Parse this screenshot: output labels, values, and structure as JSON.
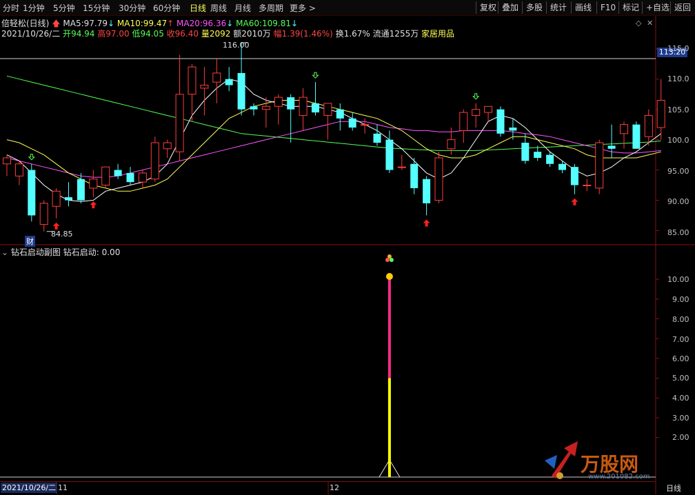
{
  "toolbar": {
    "periods": [
      "分时",
      "1分钟",
      "5分钟",
      "15分钟",
      "30分钟",
      "60分钟",
      "日线",
      "周线",
      "月线",
      "多周期",
      "更多"
    ],
    "active_period": "日线",
    "more_arrow": ">",
    "buttons": [
      "复权",
      "叠加",
      "多股",
      "统计",
      "画线",
      "F10",
      "标记",
      "+自选",
      "返回"
    ]
  },
  "info": {
    "title": "倍轻松(日线)",
    "ma5_label": "MA5:",
    "ma5": "97.79",
    "ma10_label": "MA10:",
    "ma10": "99.47",
    "ma20_label": "MA20:",
    "ma20": "96.36",
    "ma60_label": "MA60:",
    "ma60": "109.81",
    "date": "2021/10/26/二",
    "open_label": "开",
    "open": "94.94",
    "high_label": "高",
    "high": "97.00",
    "low_label": "低",
    "low": "94.05",
    "close_label": "收",
    "close": "96.40",
    "vol_label": "量",
    "vol": "2092",
    "amount_label": "额",
    "amount": "2010万",
    "change_label": "幅",
    "change": "1.39(1.46%)",
    "turnover_label": "换",
    "turnover": "1.67%",
    "float_label": "流通",
    "float": "1255万",
    "sector": "家居用品"
  },
  "price_axis": {
    "labels": [
      "115.0",
      "110.0",
      "105.0",
      "100.0",
      "95.00",
      "90.00",
      "85.00"
    ],
    "current_tag": "113.20"
  },
  "annotations": {
    "high_label": "116.00",
    "low_label": "84.85",
    "cai": "财"
  },
  "sub": {
    "title": "钻石启动副图",
    "value_label": "钻石启动:",
    "value": "0.00",
    "axis_labels": [
      "10.00",
      "9.00",
      "8.00",
      "7.00",
      "6.00",
      "5.00",
      "4.00",
      "3.00",
      "2.00"
    ]
  },
  "bottom": {
    "date": "2021/10/26/二",
    "month1": "11",
    "month2": "12",
    "period_label": "日线"
  },
  "watermark": {
    "text": "万股网",
    "url": "www.201082.com"
  },
  "colors": {
    "up": "#ff3c3c",
    "down": "#54ffff",
    "ma5": "#ffffff",
    "ma10": "#ffff55",
    "ma20": "#ff55ff",
    "ma60": "#55ff55",
    "signal_top": "#ff2a8a",
    "signal_bottom": "#ffff00",
    "border": "#8a1010"
  },
  "chart_data": {
    "type": "candlestick",
    "ylim": [
      83,
      116
    ],
    "candles": [
      {
        "o": 96.0,
        "h": 97.5,
        "l": 94.0,
        "c": 97.0
      },
      {
        "o": 94.0,
        "h": 96.5,
        "l": 92.5,
        "c": 96.0
      },
      {
        "o": 95.0,
        "h": 96.0,
        "l": 86.5,
        "c": 87.5
      },
      {
        "o": 86.0,
        "h": 90.0,
        "l": 84.85,
        "c": 89.5
      },
      {
        "o": 89.0,
        "h": 92.0,
        "l": 87.0,
        "c": 91.5
      },
      {
        "o": 90.5,
        "h": 93.0,
        "l": 89.0,
        "c": 90.0
      },
      {
        "o": 93.5,
        "h": 94.5,
        "l": 89.5,
        "c": 90.0
      },
      {
        "o": 92.0,
        "h": 95.0,
        "l": 90.5,
        "c": 93.5
      },
      {
        "o": 92.5,
        "h": 95.5,
        "l": 92.0,
        "c": 95.5
      },
      {
        "o": 95.0,
        "h": 96.0,
        "l": 93.5,
        "c": 94.0
      },
      {
        "o": 94.5,
        "h": 95.5,
        "l": 92.5,
        "c": 93.0
      },
      {
        "o": 93.0,
        "h": 95.0,
        "l": 92.0,
        "c": 94.5
      },
      {
        "o": 93.5,
        "h": 100.5,
        "l": 93.0,
        "c": 99.5
      },
      {
        "o": 98.5,
        "h": 100.0,
        "l": 97.0,
        "c": 99.5
      },
      {
        "o": 98.0,
        "h": 114.0,
        "l": 96.5,
        "c": 107.5
      },
      {
        "o": 107.5,
        "h": 112.5,
        "l": 103.0,
        "c": 112.0
      },
      {
        "o": 108.5,
        "h": 112.0,
        "l": 104.0,
        "c": 109.0
      },
      {
        "o": 109.5,
        "h": 113.5,
        "l": 106.0,
        "c": 111.0
      },
      {
        "o": 110.0,
        "h": 112.0,
        "l": 108.0,
        "c": 109.0
      },
      {
        "o": 111.0,
        "h": 116.0,
        "l": 104.0,
        "c": 105.0
      },
      {
        "o": 105.5,
        "h": 106.0,
        "l": 104.0,
        "c": 105.0
      },
      {
        "o": 105.0,
        "h": 107.0,
        "l": 102.0,
        "c": 105.5
      },
      {
        "o": 105.5,
        "h": 107.5,
        "l": 102.5,
        "c": 107.0
      },
      {
        "o": 107.0,
        "h": 107.5,
        "l": 99.5,
        "c": 105.0
      },
      {
        "o": 104.0,
        "h": 108.5,
        "l": 101.5,
        "c": 107.0
      },
      {
        "o": 106.0,
        "h": 109.5,
        "l": 104.0,
        "c": 104.5
      },
      {
        "o": 104.0,
        "h": 106.0,
        "l": 100.0,
        "c": 106.0
      },
      {
        "o": 105.0,
        "h": 106.0,
        "l": 101.5,
        "c": 103.5
      },
      {
        "o": 103.5,
        "h": 104.5,
        "l": 101.5,
        "c": 102.0
      },
      {
        "o": 102.5,
        "h": 103.5,
        "l": 101.0,
        "c": 102.5
      },
      {
        "o": 101.0,
        "h": 102.5,
        "l": 99.0,
        "c": 99.5
      },
      {
        "o": 100.0,
        "h": 101.5,
        "l": 94.5,
        "c": 95.0
      },
      {
        "o": 95.5,
        "h": 97.5,
        "l": 95.0,
        "c": 95.5
      },
      {
        "o": 96.0,
        "h": 97.0,
        "l": 91.0,
        "c": 92.0
      },
      {
        "o": 93.5,
        "h": 94.0,
        "l": 87.5,
        "c": 89.5
      },
      {
        "o": 90.0,
        "h": 98.0,
        "l": 89.5,
        "c": 97.0
      },
      {
        "o": 98.5,
        "h": 102.0,
        "l": 97.5,
        "c": 100.0
      },
      {
        "o": 101.5,
        "h": 105.0,
        "l": 99.5,
        "c": 104.5
      },
      {
        "o": 104.0,
        "h": 106.0,
        "l": 102.0,
        "c": 105.0
      },
      {
        "o": 104.5,
        "h": 105.5,
        "l": 103.0,
        "c": 105.5
      },
      {
        "o": 105.0,
        "h": 105.5,
        "l": 100.5,
        "c": 101.0
      },
      {
        "o": 102.0,
        "h": 103.5,
        "l": 100.0,
        "c": 101.5
      },
      {
        "o": 99.5,
        "h": 101.0,
        "l": 96.0,
        "c": 96.5
      },
      {
        "o": 98.0,
        "h": 99.0,
        "l": 96.5,
        "c": 97.0
      },
      {
        "o": 97.5,
        "h": 98.0,
        "l": 95.5,
        "c": 96.0
      },
      {
        "o": 96.0,
        "h": 96.5,
        "l": 94.5,
        "c": 95.0
      },
      {
        "o": 95.5,
        "h": 96.0,
        "l": 91.0,
        "c": 92.5
      },
      {
        "o": 92.5,
        "h": 93.5,
        "l": 91.5,
        "c": 92.5
      },
      {
        "o": 92.0,
        "h": 100.0,
        "l": 91.0,
        "c": 99.5
      },
      {
        "o": 99.0,
        "h": 102.5,
        "l": 97.0,
        "c": 98.5
      },
      {
        "o": 101.0,
        "h": 103.0,
        "l": 98.5,
        "c": 102.5
      },
      {
        "o": 102.5,
        "h": 103.0,
        "l": 98.5,
        "c": 98.5
      },
      {
        "o": 100.5,
        "h": 105.0,
        "l": 99.0,
        "c": 104.0
      },
      {
        "o": 102.0,
        "h": 110.0,
        "l": 100.0,
        "c": 106.5
      }
    ],
    "ma5": [
      97.5,
      96.5,
      94.5,
      92.5,
      91.0,
      90.0,
      89.8,
      90.0,
      91.5,
      92.0,
      92.5,
      93.0,
      94.0,
      96.0,
      100.0,
      104.0,
      106.5,
      108.5,
      110.0,
      109.5,
      107.5,
      106.5,
      106.0,
      105.5,
      105.5,
      105.5,
      105.0,
      104.5,
      103.5,
      102.5,
      101.5,
      100.0,
      98.5,
      96.5,
      94.5,
      93.5,
      94.5,
      97.0,
      100.0,
      103.0,
      104.0,
      103.5,
      102.0,
      100.0,
      98.0,
      96.5,
      95.0,
      94.0,
      94.5,
      95.5,
      97.0,
      98.0,
      99.5,
      101.0
    ],
    "ma10": [
      100.0,
      99.5,
      98.5,
      97.5,
      96.0,
      94.5,
      93.5,
      92.5,
      92.0,
      91.5,
      91.5,
      92.0,
      92.5,
      93.5,
      95.5,
      97.5,
      99.5,
      101.5,
      103.5,
      104.5,
      105.5,
      106.0,
      106.5,
      106.5,
      106.5,
      106.0,
      105.5,
      105.0,
      104.5,
      104.0,
      103.5,
      102.5,
      101.5,
      100.0,
      98.5,
      97.5,
      97.0,
      97.0,
      97.5,
      98.5,
      99.5,
      100.5,
      100.5,
      100.0,
      99.5,
      99.0,
      98.5,
      97.5,
      97.0,
      97.0,
      97.0,
      97.0,
      97.5,
      98.0
    ],
    "ma20": [
      97.0,
      96.5,
      96.0,
      95.5,
      95.0,
      94.5,
      94.0,
      93.8,
      93.8,
      94.0,
      94.5,
      95.0,
      95.5,
      96.0,
      96.5,
      97.0,
      97.5,
      98.0,
      98.5,
      99.0,
      99.5,
      100.0,
      100.5,
      101.0,
      101.5,
      102.0,
      102.5,
      103.0,
      103.0,
      103.0,
      102.5,
      102.0,
      101.8,
      101.5,
      101.5,
      101.3,
      101.3,
      101.5,
      101.5,
      101.5,
      101.5,
      101.3,
      101.0,
      100.8,
      100.5,
      100.0,
      99.5,
      99.0,
      98.5,
      98.0,
      97.8,
      97.8,
      98.0,
      98.2
    ],
    "ma60": [
      110.5,
      110.0,
      109.5,
      109.0,
      108.5,
      108.0,
      107.5,
      107.0,
      106.5,
      106.0,
      105.5,
      105.0,
      104.5,
      104.0,
      103.5,
      103.0,
      102.5,
      102.0,
      101.5,
      101.0,
      100.8,
      100.6,
      100.4,
      100.2,
      100.0,
      99.8,
      99.6,
      99.4,
      99.2,
      99.0,
      98.8,
      98.6,
      98.5,
      98.4,
      98.3,
      98.2,
      98.2,
      98.2,
      98.2,
      98.3,
      98.4,
      98.5,
      98.6,
      98.7,
      98.8,
      98.9,
      99.0,
      99.1,
      99.2,
      99.3,
      99.4,
      99.5,
      99.6,
      99.8
    ],
    "buy_arrows": [
      4,
      7,
      34,
      46
    ],
    "hollow_arrows": [
      2,
      25,
      38
    ],
    "signal": {
      "index": 31,
      "value": 10
    }
  }
}
